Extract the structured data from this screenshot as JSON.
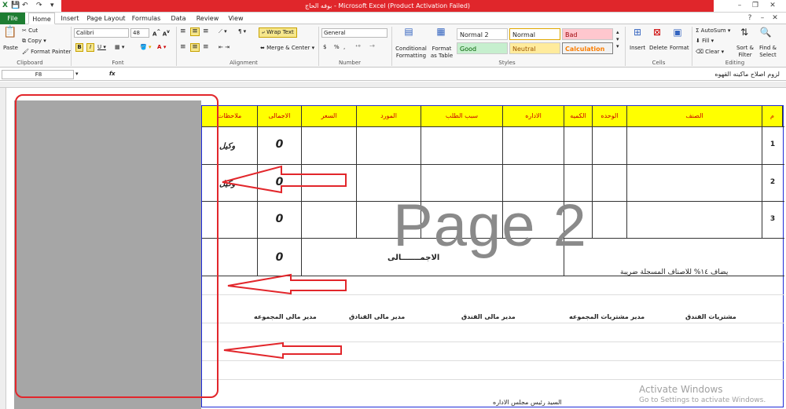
{
  "titlebar": {
    "title": "بوفه الحاج - Microsoft Excel (Product Activation Failed)",
    "qat": [
      "X",
      "💾",
      "↶",
      "↷",
      "▾"
    ]
  },
  "tabs": [
    {
      "label": "File"
    },
    {
      "label": "Home"
    },
    {
      "label": "Insert"
    },
    {
      "label": "Page Layout"
    },
    {
      "label": "Formulas"
    },
    {
      "label": "Data"
    },
    {
      "label": "Review"
    },
    {
      "label": "View"
    }
  ],
  "ribbon": {
    "clipboard": {
      "paste": "Paste",
      "cut": "Cut",
      "copy": "Copy",
      "painter": "Format Painter",
      "label": "Clipboard"
    },
    "font": {
      "name": "Calibri",
      "size": "48",
      "label": "Font"
    },
    "alignment": {
      "wrap": "Wrap Text",
      "merge": "Merge & Center",
      "label": "Alignment"
    },
    "number": {
      "format": "General",
      "label": "Number",
      "currency": "$",
      "percent": "%",
      "comma": ","
    },
    "styles": {
      "conditional": "Conditional Formatting",
      "format_table": "Format as Table",
      "normal2": "Normal 2",
      "normal": "Normal",
      "bad": "Bad",
      "good": "Good",
      "neutral": "Neutral",
      "calculation": "Calculation",
      "label": "Styles"
    },
    "cells": {
      "insert": "Insert",
      "delete": "Delete",
      "format": "Format",
      "label": "Cells"
    },
    "editing": {
      "autosum": "AutoSum",
      "fill": "Fill",
      "clear": "Clear",
      "sort": "Sort & Filter",
      "find": "Find & Select",
      "label": "Editing"
    }
  },
  "formulabar": {
    "cell_ref": "F8",
    "fx": "fx",
    "content": "لزوم اصلاح ماكينه القهوه"
  },
  "sheet": {
    "watermark": "Page 2",
    "headers": [
      "م",
      "الصنف",
      "الوحده",
      "الكميه",
      "الاداره",
      "سبب الطلب",
      "المورد",
      "السعر",
      "الاجمالى",
      "ملاحظات"
    ],
    "rows": [
      {
        "no": "1",
        "total": "0",
        "note": "وكيل"
      },
      {
        "no": "2",
        "total": "0",
        "note": "وكيل"
      },
      {
        "no": "3",
        "total": "0"
      }
    ],
    "grand_total_label": "الاجمـــــــالى",
    "grand_total_value": "0",
    "tax_note": "يضاف ١٤% للاصناف المسجلة ضريبة",
    "signatures": [
      "مشتريات الفندق",
      "مدير مشتريات المجموعه",
      "مدير مالى الفندق",
      "مدير مالى الفنادق",
      "مدير مالى المجموعه"
    ],
    "board": "السيد رئيس مجلس الاداره"
  },
  "activation": {
    "title": "Activate Windows",
    "subtitle": "Go to Settings to activate Windows."
  },
  "colors": {
    "accent_red": "#e2262b",
    "header_yellow": "#ffff00",
    "page_border": "#1f2bd6"
  }
}
